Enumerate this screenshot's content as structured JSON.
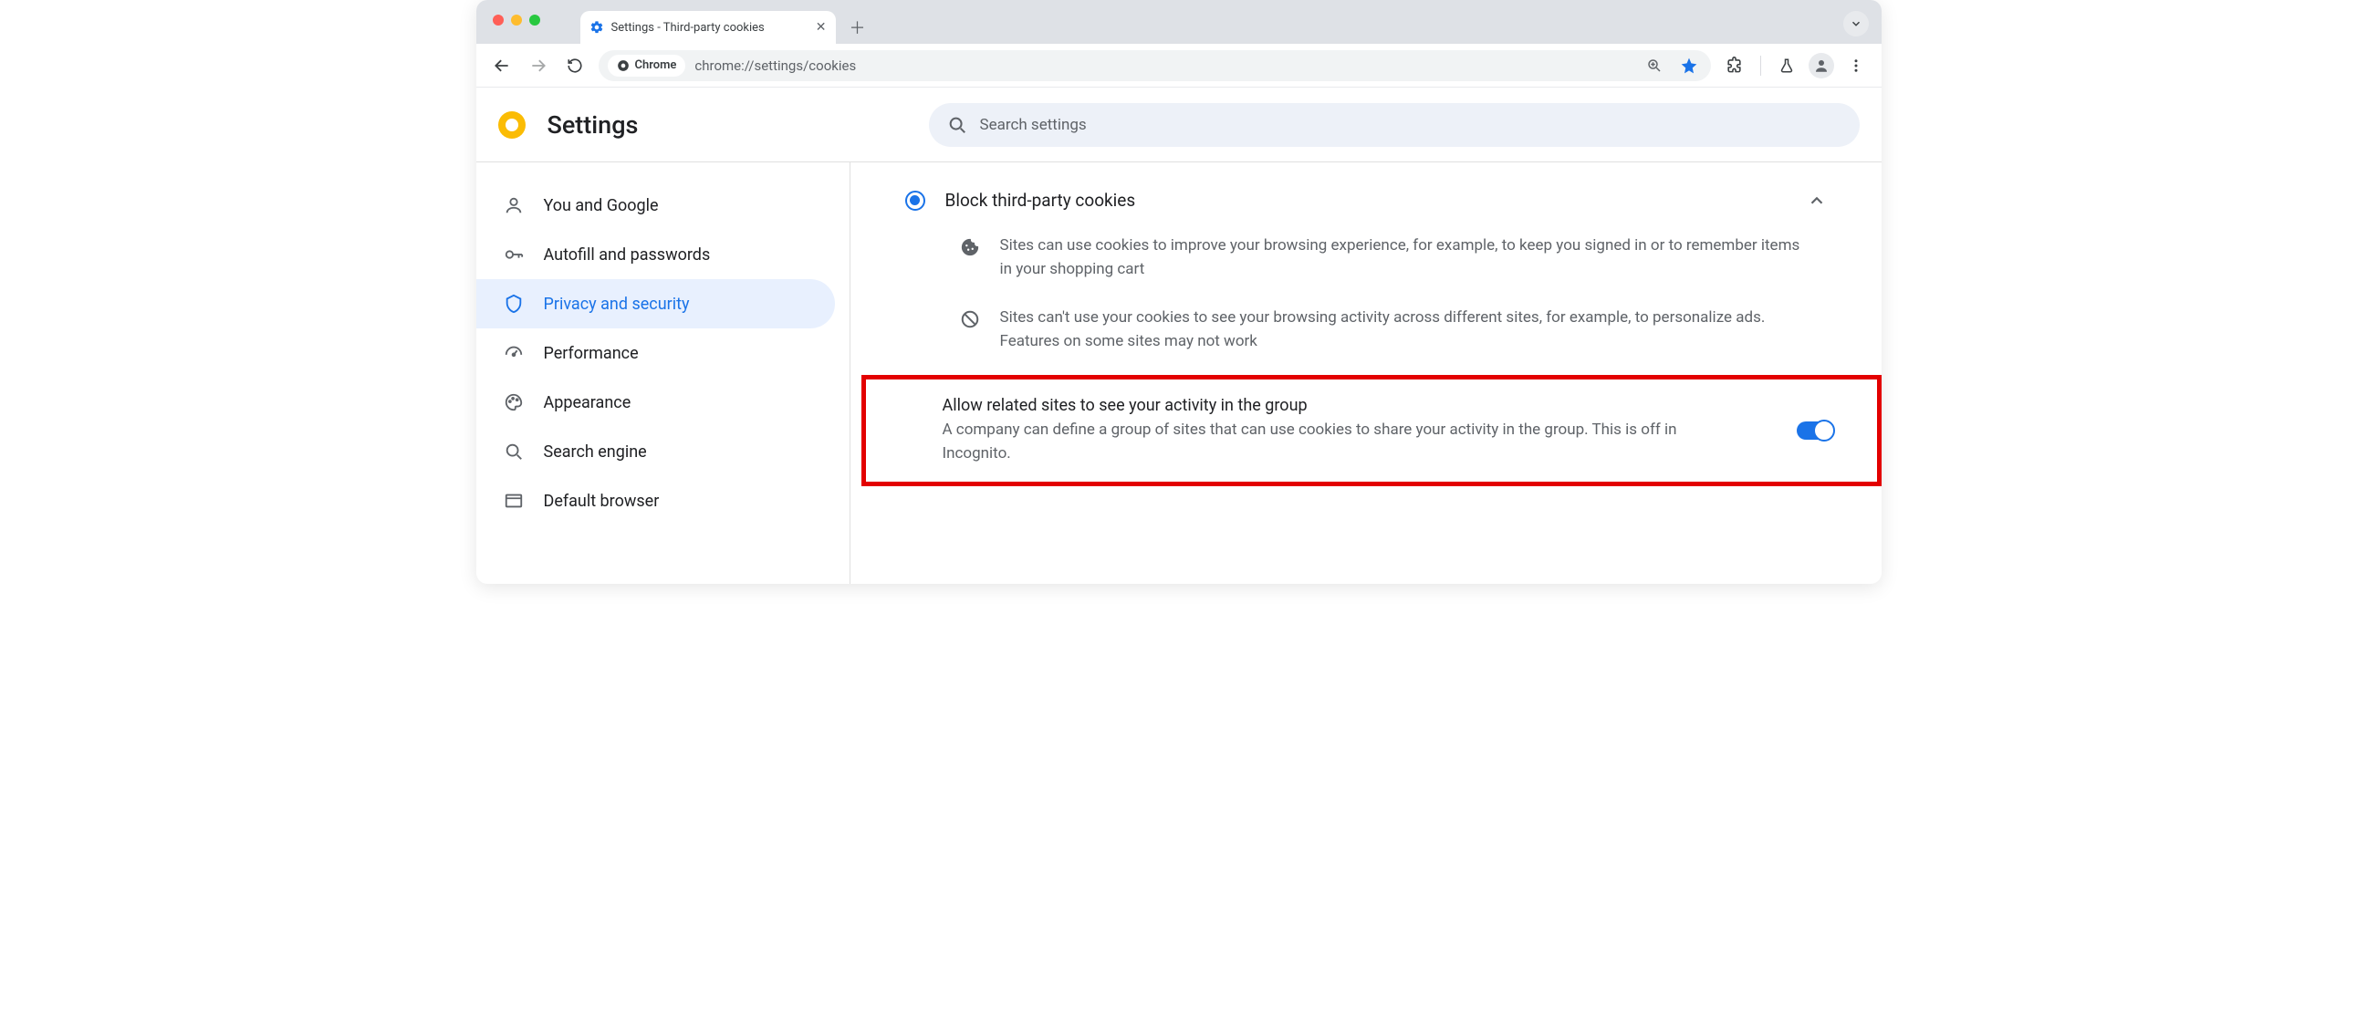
{
  "window": {
    "tab_title": "Settings - Third-party cookies",
    "omnibox_chip": "Chrome",
    "url": "chrome://settings/cookies"
  },
  "header": {
    "title": "Settings",
    "search_placeholder": "Search settings"
  },
  "sidebar": {
    "items": [
      {
        "label": "You and Google"
      },
      {
        "label": "Autofill and passwords"
      },
      {
        "label": "Privacy and security"
      },
      {
        "label": "Performance"
      },
      {
        "label": "Appearance"
      },
      {
        "label": "Search engine"
      },
      {
        "label": "Default browser"
      }
    ]
  },
  "content": {
    "option_title": "Block third-party cookies",
    "desc1": "Sites can use cookies to improve your browsing experience, for example, to keep you signed in or to remember items in your shopping cart",
    "desc2": "Sites can't use your cookies to see your browsing activity across different sites, for example, to personalize ads. Features on some sites may not work",
    "related_title": "Allow related sites to see your activity in the group",
    "related_desc": "A company can define a group of sites that can use cookies to share your activity in the group. This is off in Incognito.",
    "toggle_on": true
  }
}
